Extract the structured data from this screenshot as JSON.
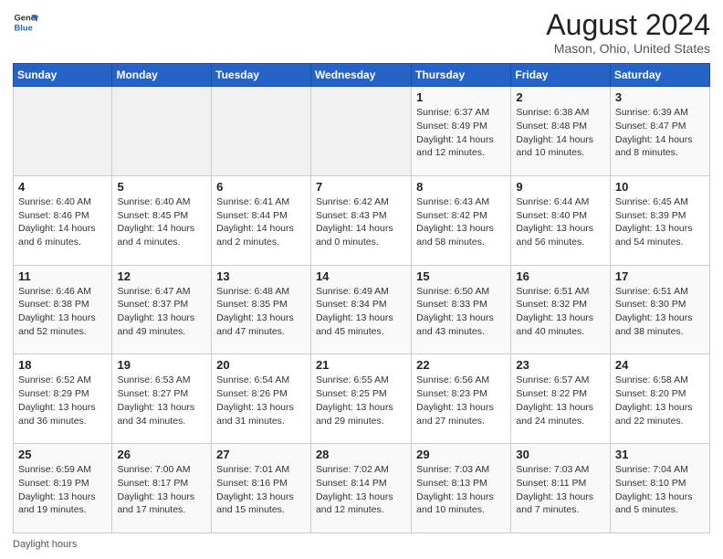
{
  "header": {
    "logo_general": "General",
    "logo_blue": "Blue",
    "main_title": "August 2024",
    "subtitle": "Mason, Ohio, United States"
  },
  "days_of_week": [
    "Sunday",
    "Monday",
    "Tuesday",
    "Wednesday",
    "Thursday",
    "Friday",
    "Saturday"
  ],
  "weeks": [
    [
      {
        "day": "",
        "info": ""
      },
      {
        "day": "",
        "info": ""
      },
      {
        "day": "",
        "info": ""
      },
      {
        "day": "",
        "info": ""
      },
      {
        "day": "1",
        "info": "Sunrise: 6:37 AM\nSunset: 8:49 PM\nDaylight: 14 hours and 12 minutes."
      },
      {
        "day": "2",
        "info": "Sunrise: 6:38 AM\nSunset: 8:48 PM\nDaylight: 14 hours and 10 minutes."
      },
      {
        "day": "3",
        "info": "Sunrise: 6:39 AM\nSunset: 8:47 PM\nDaylight: 14 hours and 8 minutes."
      }
    ],
    [
      {
        "day": "4",
        "info": "Sunrise: 6:40 AM\nSunset: 8:46 PM\nDaylight: 14 hours and 6 minutes."
      },
      {
        "day": "5",
        "info": "Sunrise: 6:40 AM\nSunset: 8:45 PM\nDaylight: 14 hours and 4 minutes."
      },
      {
        "day": "6",
        "info": "Sunrise: 6:41 AM\nSunset: 8:44 PM\nDaylight: 14 hours and 2 minutes."
      },
      {
        "day": "7",
        "info": "Sunrise: 6:42 AM\nSunset: 8:43 PM\nDaylight: 14 hours and 0 minutes."
      },
      {
        "day": "8",
        "info": "Sunrise: 6:43 AM\nSunset: 8:42 PM\nDaylight: 13 hours and 58 minutes."
      },
      {
        "day": "9",
        "info": "Sunrise: 6:44 AM\nSunset: 8:40 PM\nDaylight: 13 hours and 56 minutes."
      },
      {
        "day": "10",
        "info": "Sunrise: 6:45 AM\nSunset: 8:39 PM\nDaylight: 13 hours and 54 minutes."
      }
    ],
    [
      {
        "day": "11",
        "info": "Sunrise: 6:46 AM\nSunset: 8:38 PM\nDaylight: 13 hours and 52 minutes."
      },
      {
        "day": "12",
        "info": "Sunrise: 6:47 AM\nSunset: 8:37 PM\nDaylight: 13 hours and 49 minutes."
      },
      {
        "day": "13",
        "info": "Sunrise: 6:48 AM\nSunset: 8:35 PM\nDaylight: 13 hours and 47 minutes."
      },
      {
        "day": "14",
        "info": "Sunrise: 6:49 AM\nSunset: 8:34 PM\nDaylight: 13 hours and 45 minutes."
      },
      {
        "day": "15",
        "info": "Sunrise: 6:50 AM\nSunset: 8:33 PM\nDaylight: 13 hours and 43 minutes."
      },
      {
        "day": "16",
        "info": "Sunrise: 6:51 AM\nSunset: 8:32 PM\nDaylight: 13 hours and 40 minutes."
      },
      {
        "day": "17",
        "info": "Sunrise: 6:51 AM\nSunset: 8:30 PM\nDaylight: 13 hours and 38 minutes."
      }
    ],
    [
      {
        "day": "18",
        "info": "Sunrise: 6:52 AM\nSunset: 8:29 PM\nDaylight: 13 hours and 36 minutes."
      },
      {
        "day": "19",
        "info": "Sunrise: 6:53 AM\nSunset: 8:27 PM\nDaylight: 13 hours and 34 minutes."
      },
      {
        "day": "20",
        "info": "Sunrise: 6:54 AM\nSunset: 8:26 PM\nDaylight: 13 hours and 31 minutes."
      },
      {
        "day": "21",
        "info": "Sunrise: 6:55 AM\nSunset: 8:25 PM\nDaylight: 13 hours and 29 minutes."
      },
      {
        "day": "22",
        "info": "Sunrise: 6:56 AM\nSunset: 8:23 PM\nDaylight: 13 hours and 27 minutes."
      },
      {
        "day": "23",
        "info": "Sunrise: 6:57 AM\nSunset: 8:22 PM\nDaylight: 13 hours and 24 minutes."
      },
      {
        "day": "24",
        "info": "Sunrise: 6:58 AM\nSunset: 8:20 PM\nDaylight: 13 hours and 22 minutes."
      }
    ],
    [
      {
        "day": "25",
        "info": "Sunrise: 6:59 AM\nSunset: 8:19 PM\nDaylight: 13 hours and 19 minutes."
      },
      {
        "day": "26",
        "info": "Sunrise: 7:00 AM\nSunset: 8:17 PM\nDaylight: 13 hours and 17 minutes."
      },
      {
        "day": "27",
        "info": "Sunrise: 7:01 AM\nSunset: 8:16 PM\nDaylight: 13 hours and 15 minutes."
      },
      {
        "day": "28",
        "info": "Sunrise: 7:02 AM\nSunset: 8:14 PM\nDaylight: 13 hours and 12 minutes."
      },
      {
        "day": "29",
        "info": "Sunrise: 7:03 AM\nSunset: 8:13 PM\nDaylight: 13 hours and 10 minutes."
      },
      {
        "day": "30",
        "info": "Sunrise: 7:03 AM\nSunset: 8:11 PM\nDaylight: 13 hours and 7 minutes."
      },
      {
        "day": "31",
        "info": "Sunrise: 7:04 AM\nSunset: 8:10 PM\nDaylight: 13 hours and 5 minutes."
      }
    ]
  ],
  "footer": {
    "note": "Daylight hours"
  }
}
